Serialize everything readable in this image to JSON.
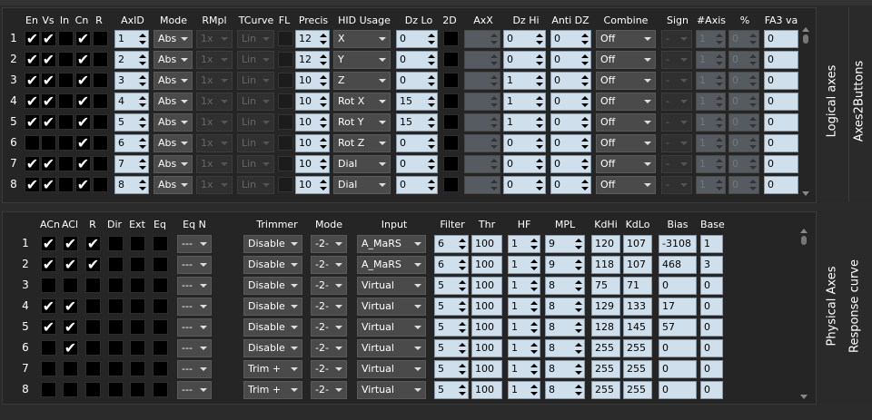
{
  "logical": {
    "headers": {
      "en": "En",
      "vs": "Vs",
      "in": "In",
      "cn": "Cn",
      "r": "R",
      "axid": "AxID",
      "mode": "Mode",
      "rmpl": "RMpl",
      "tcurve": "TCurve",
      "fl": "FL",
      "precis": "Precis",
      "hid": "HID Usage",
      "dzlo": "Dz Lo",
      "2d": "2D",
      "axx": "AxX",
      "dzhi": "Dz Hi",
      "antidz": "Anti DZ",
      "combine": "Combine",
      "sign": "Sign",
      "naxis": "#Axis",
      "pct": "%",
      "fa3": "FA3 va"
    },
    "side_labels": {
      "a": "Logical axes",
      "b": "Axes2Buttons"
    },
    "rows": [
      {
        "n": "1",
        "en": true,
        "vs": true,
        "in": false,
        "cn": true,
        "r": false,
        "axid": "1",
        "mode": "Abs",
        "rmpl": "1x",
        "tcurve": "Lin",
        "precis": "12",
        "hid": "X",
        "dzlo": "0",
        "axx": "",
        "dzhi": "0",
        "antidz": "0",
        "combine": "Off",
        "sign": "-",
        "naxis": "1",
        "pct": "0",
        "fa3": "0"
      },
      {
        "n": "2",
        "en": true,
        "vs": true,
        "in": false,
        "cn": true,
        "r": false,
        "axid": "2",
        "mode": "Abs",
        "rmpl": "1x",
        "tcurve": "Lin",
        "precis": "12",
        "hid": "Y",
        "dzlo": "0",
        "axx": "",
        "dzhi": "0",
        "antidz": "0",
        "combine": "Off",
        "sign": "-",
        "naxis": "1",
        "pct": "0",
        "fa3": "0"
      },
      {
        "n": "3",
        "en": true,
        "vs": true,
        "in": false,
        "cn": true,
        "r": false,
        "axid": "3",
        "mode": "Abs",
        "rmpl": "1x",
        "tcurve": "Lin",
        "precis": "10",
        "hid": "Z",
        "dzlo": "0",
        "axx": "",
        "dzhi": "1",
        "antidz": "0",
        "combine": "Off",
        "sign": "-",
        "naxis": "1",
        "pct": "0",
        "fa3": "0"
      },
      {
        "n": "4",
        "en": true,
        "vs": true,
        "in": false,
        "cn": true,
        "r": false,
        "axid": "4",
        "mode": "Abs",
        "rmpl": "1x",
        "tcurve": "Lin",
        "precis": "10",
        "hid": "Rot X",
        "dzlo": "15",
        "axx": "",
        "dzhi": "1",
        "antidz": "0",
        "combine": "Off",
        "sign": "-",
        "naxis": "1",
        "pct": "0",
        "fa3": "0"
      },
      {
        "n": "5",
        "en": true,
        "vs": true,
        "in": false,
        "cn": true,
        "r": false,
        "axid": "5",
        "mode": "Abs",
        "rmpl": "1x",
        "tcurve": "Lin",
        "precis": "10",
        "hid": "Rot Y",
        "dzlo": "15",
        "axx": "",
        "dzhi": "1",
        "antidz": "0",
        "combine": "Off",
        "sign": "-",
        "naxis": "1",
        "pct": "0",
        "fa3": "0"
      },
      {
        "n": "6",
        "en": false,
        "vs": false,
        "in": false,
        "cn": true,
        "r": false,
        "axid": "6",
        "mode": "Abs",
        "rmpl": "1x",
        "tcurve": "Lin",
        "precis": "10",
        "hid": "Rot Z",
        "dzlo": "0",
        "axx": "",
        "dzhi": "0",
        "antidz": "0",
        "combine": "Off",
        "sign": "-",
        "naxis": "1",
        "pct": "0",
        "fa3": "0"
      },
      {
        "n": "7",
        "en": true,
        "vs": true,
        "in": false,
        "cn": true,
        "r": false,
        "axid": "7",
        "mode": "Abs",
        "rmpl": "1x",
        "tcurve": "Lin",
        "precis": "10",
        "hid": "Dial",
        "dzlo": "0",
        "axx": "",
        "dzhi": "0",
        "antidz": "0",
        "combine": "Off",
        "sign": "-",
        "naxis": "1",
        "pct": "0",
        "fa3": "0"
      },
      {
        "n": "8",
        "en": true,
        "vs": true,
        "in": false,
        "cn": true,
        "r": false,
        "axid": "8",
        "mode": "Abs",
        "rmpl": "1x",
        "tcurve": "Lin",
        "precis": "10",
        "hid": "Dial",
        "dzlo": "0",
        "axx": "",
        "dzhi": "0",
        "antidz": "0",
        "combine": "Off",
        "sign": "-",
        "naxis": "1",
        "pct": "0",
        "fa3": "0"
      }
    ]
  },
  "physical": {
    "headers": {
      "acn": "ACn",
      "acl": "ACl",
      "r": "R",
      "dir": "Dir",
      "ext": "Ext",
      "eq": "Eq",
      "eqn": "Eq N",
      "trimmer": "Trimmer",
      "mode": "Mode",
      "input": "Input",
      "filter": "Filter",
      "thr": "Thr",
      "hf": "HF",
      "mpl": "MPL",
      "kdhi": "KdHi",
      "kdlo": "KdLo",
      "bias": "Bias",
      "base": "Base"
    },
    "side_labels": {
      "a": "Physical Axes",
      "b": "Response curve"
    },
    "rows": [
      {
        "n": "1",
        "acn": true,
        "acl": true,
        "r": true,
        "dir": false,
        "ext": false,
        "eq": false,
        "eqn": "---",
        "trimmer": "Disable",
        "mode": "-2-",
        "input": "A_MaRS",
        "filter": "6",
        "thr": "100",
        "hf": "1",
        "mpl": "9",
        "kdhi": "120",
        "kdlo": "107",
        "bias": "-3108",
        "base": "1"
      },
      {
        "n": "2",
        "acn": true,
        "acl": true,
        "r": true,
        "dir": false,
        "ext": false,
        "eq": false,
        "eqn": "---",
        "trimmer": "Disable",
        "mode": "-2-",
        "input": "A_MaRS",
        "filter": "6",
        "thr": "100",
        "hf": "1",
        "mpl": "9",
        "kdhi": "118",
        "kdlo": "107",
        "bias": "468",
        "base": "3"
      },
      {
        "n": "3",
        "acn": false,
        "acl": false,
        "r": false,
        "dir": false,
        "ext": false,
        "eq": false,
        "eqn": "---",
        "trimmer": "Disable",
        "mode": "-2-",
        "input": "Virtual",
        "filter": "5",
        "thr": "100",
        "hf": "1",
        "mpl": "8",
        "kdhi": "75",
        "kdlo": "71",
        "bias": "0",
        "base": "0"
      },
      {
        "n": "4",
        "acn": true,
        "acl": true,
        "r": false,
        "dir": false,
        "ext": false,
        "eq": false,
        "eqn": "---",
        "trimmer": "Disable",
        "mode": "-2-",
        "input": "Virtual",
        "filter": "5",
        "thr": "100",
        "hf": "1",
        "mpl": "8",
        "kdhi": "129",
        "kdlo": "133",
        "bias": "17",
        "base": "0"
      },
      {
        "n": "5",
        "acn": true,
        "acl": true,
        "r": false,
        "dir": false,
        "ext": false,
        "eq": false,
        "eqn": "---",
        "trimmer": "Disable",
        "mode": "-2-",
        "input": "Virtual",
        "filter": "5",
        "thr": "100",
        "hf": "1",
        "mpl": "8",
        "kdhi": "128",
        "kdlo": "145",
        "bias": "57",
        "base": "0"
      },
      {
        "n": "6",
        "acn": false,
        "acl": true,
        "r": false,
        "dir": false,
        "ext": false,
        "eq": false,
        "eqn": "---",
        "trimmer": "Disable",
        "mode": "-2-",
        "input": "Virtual",
        "filter": "5",
        "thr": "100",
        "hf": "1",
        "mpl": "8",
        "kdhi": "255",
        "kdlo": "255",
        "bias": "0",
        "base": "0"
      },
      {
        "n": "7",
        "acn": false,
        "acl": false,
        "r": false,
        "dir": false,
        "ext": false,
        "eq": false,
        "eqn": "---",
        "trimmer": "Trim +",
        "mode": "-2-",
        "input": "Virtual",
        "filter": "5",
        "thr": "100",
        "hf": "1",
        "mpl": "8",
        "kdhi": "255",
        "kdlo": "255",
        "bias": "0",
        "base": "0"
      },
      {
        "n": "8",
        "acn": false,
        "acl": false,
        "r": false,
        "dir": false,
        "ext": false,
        "eq": false,
        "eqn": "---",
        "trimmer": "Trim +",
        "mode": "-2-",
        "input": "Virtual",
        "filter": "5",
        "thr": "100",
        "hf": "1",
        "mpl": "8",
        "kdhi": "255",
        "kdlo": "255",
        "bias": "0",
        "base": "0"
      }
    ]
  }
}
